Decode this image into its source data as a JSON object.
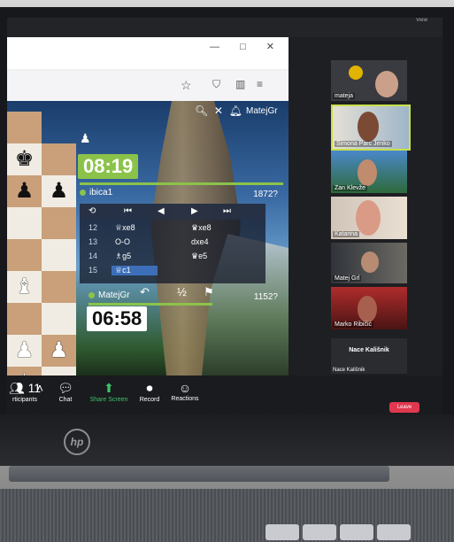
{
  "browser": {
    "toolbar_icons": [
      "star-icon",
      "shield-icon",
      "sidebar-icon",
      "menu-icon"
    ]
  },
  "game": {
    "username": "MatejGr",
    "top_clock": "08:19",
    "bottom_clock": "06:58",
    "top_player": {
      "name": "ibica1",
      "rating": "1872?"
    },
    "bottom_player": {
      "name": "MatejGr",
      "rating": "1152?"
    },
    "board_label": "atejGr",
    "moves": [
      {
        "n": "12",
        "a": "♕xe8",
        "b": "♛xe8"
      },
      {
        "n": "13",
        "a": "O-O",
        "b": "dxe4"
      },
      {
        "n": "14",
        "a": "♗g5",
        "b": "♛e5"
      },
      {
        "n": "15",
        "a": "♕c1",
        "b": ""
      }
    ],
    "half_label": "½"
  },
  "zoom": {
    "top_indicator": "View",
    "participants": [
      {
        "name": "mateja"
      },
      {
        "name": "Simona Parc Jenko"
      },
      {
        "name": "Zan Klevže"
      },
      {
        "name": "Katarina"
      },
      {
        "name": "Matej Grl"
      },
      {
        "name": "Marko Ribičić"
      }
    ],
    "name_tile": {
      "big": "Nace Kališnik",
      "small": "Nace Kališnik"
    },
    "toolbar": {
      "participants_label": "rticipants",
      "participants_count": "11",
      "chat_label": "Chat",
      "share_label": "Share Screen",
      "record_label": "Record",
      "reactions_label": "Reactions",
      "leave_label": "Leave"
    }
  },
  "laptop": {
    "brand": "hp"
  }
}
